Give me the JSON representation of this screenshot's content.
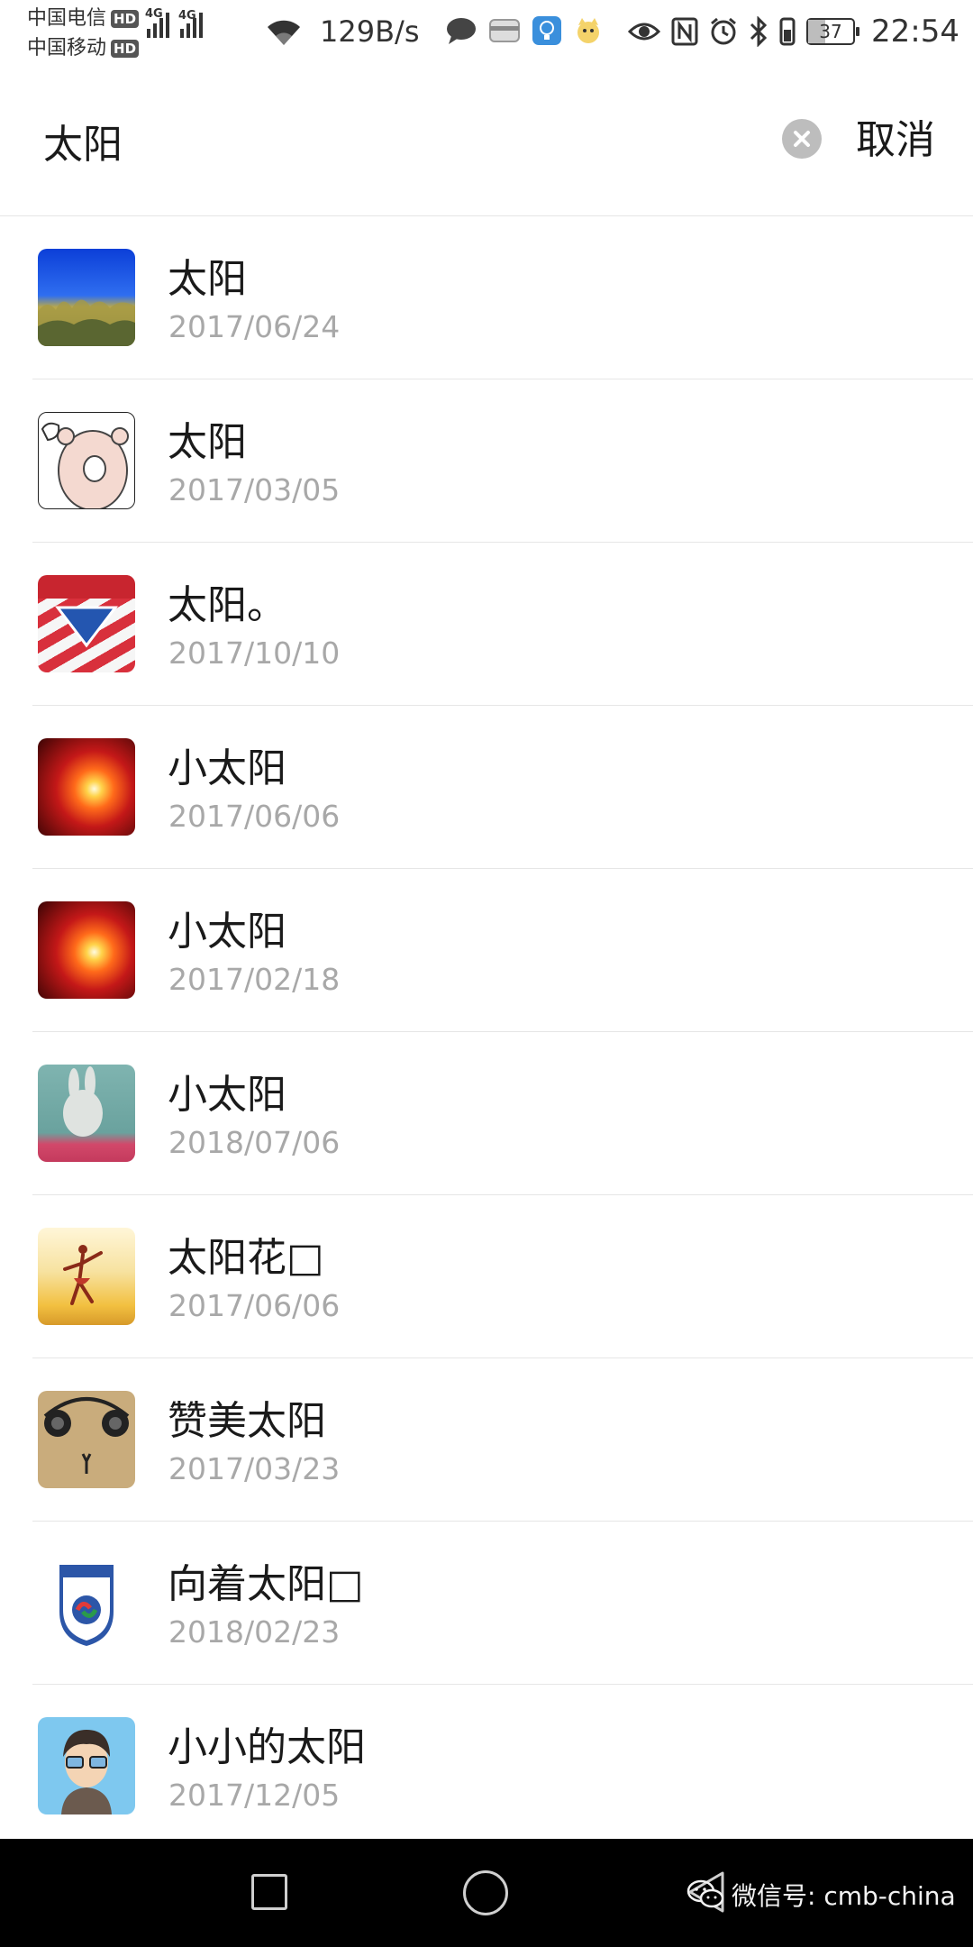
{
  "status_bar": {
    "carriers": [
      {
        "name": "中国电信",
        "badge": "HD"
      },
      {
        "name": "中国移动",
        "badge": "HD"
      }
    ],
    "network": [
      "4G",
      "4G"
    ],
    "net_speed": "129B/s",
    "battery": {
      "level": 37,
      "label": "37"
    },
    "time": "22:54",
    "notification_icons": [
      "chat-bubble-icon",
      "card-icon",
      "bulb-app-icon",
      "cat-app-icon"
    ],
    "system_icons": [
      "eye-icon",
      "nfc-icon",
      "alarm-icon",
      "bluetooth-icon",
      "vibrate-icon"
    ]
  },
  "search": {
    "query": "太阳",
    "cancel_label": "取消"
  },
  "results": [
    {
      "name": "太阳",
      "date": "2017/06/24"
    },
    {
      "name": "太阳",
      "date": "2017/03/05"
    },
    {
      "name": "太阳。",
      "date": "2017/10/10"
    },
    {
      "name": "小太阳",
      "date": "2017/06/06"
    },
    {
      "name": "小太阳",
      "date": "2017/02/18"
    },
    {
      "name": "小太阳",
      "date": "2018/07/06"
    },
    {
      "name": "太阳花□",
      "date": "2017/06/06"
    },
    {
      "name": "赞美太阳",
      "date": "2017/03/23"
    },
    {
      "name": "向着太阳□",
      "date": "2018/02/23"
    },
    {
      "name": "小小的太阳",
      "date": "2017/12/05"
    }
  ],
  "watermark": {
    "text": "微信号: cmb-china"
  },
  "colors": {
    "date_gray": "#a8a8a8",
    "divider": "#e6e6e6",
    "navbar": "#000000"
  }
}
